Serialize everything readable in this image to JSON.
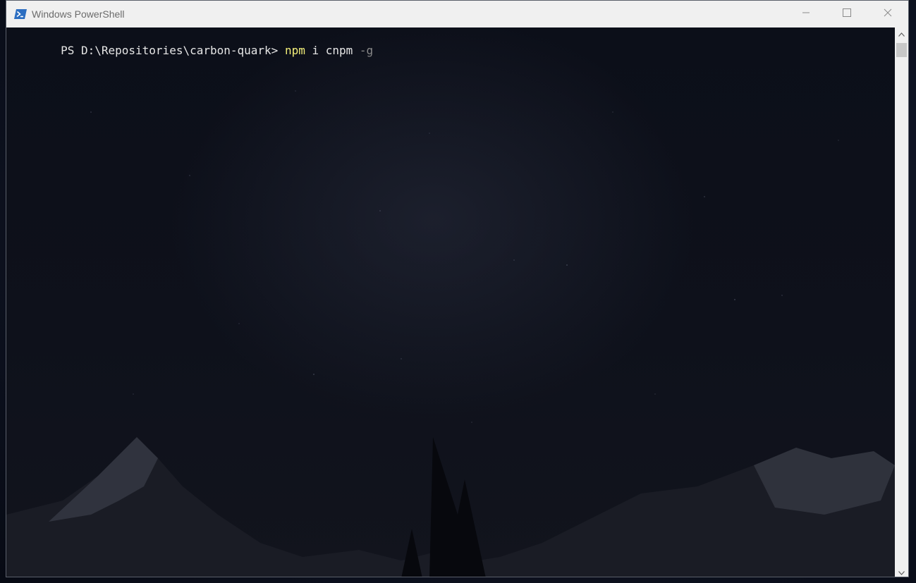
{
  "window": {
    "title": "Windows PowerShell",
    "icon": "powershell-icon",
    "controls": {
      "minimize": "minimize-icon",
      "maximize": "maximize-icon",
      "close": "close-icon"
    }
  },
  "console": {
    "prompt": "PS D:\\Repositories\\carbon-quark> ",
    "command": "npm",
    "args": " i cnpm ",
    "param": "-g"
  },
  "colors": {
    "command": "#f4f07a",
    "text": "#e6e6e6",
    "parameter": "#8a8a8a",
    "titlebar": "#f0f0f0"
  }
}
